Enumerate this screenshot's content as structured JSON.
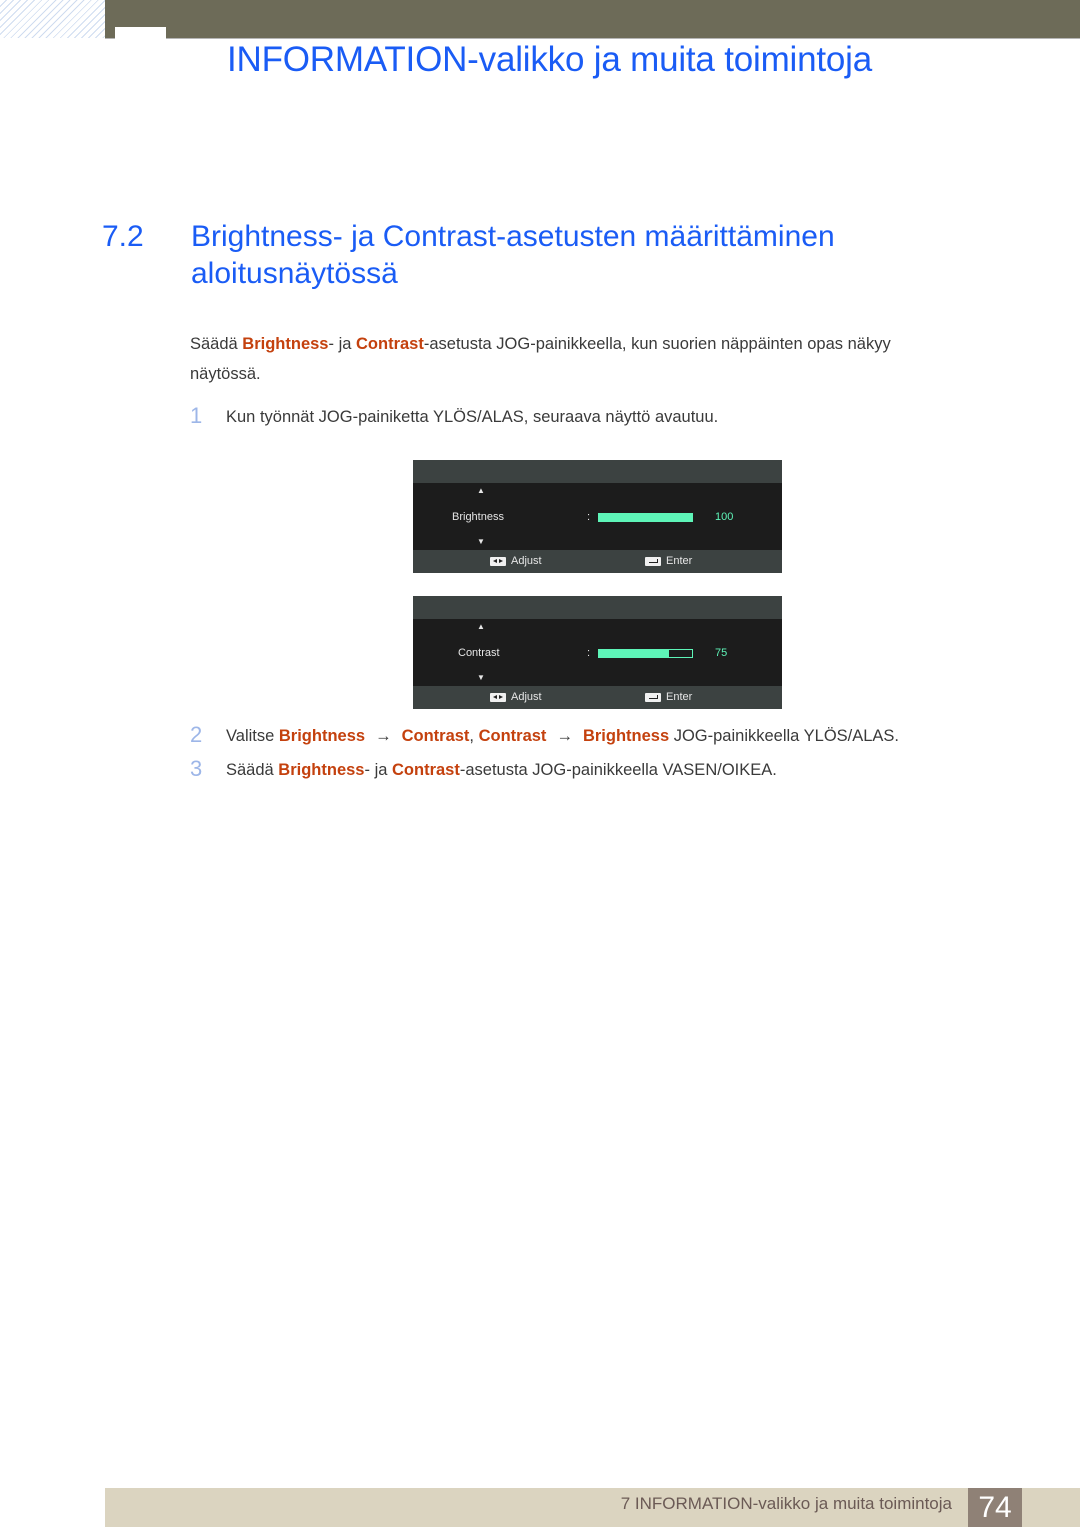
{
  "header": {
    "chapter_title": "INFORMATION-valikko ja muita toimintoja"
  },
  "section": {
    "number": "7.2",
    "title": "Brightness- ja Contrast-asetusten määrittäminen aloitusnäytössä"
  },
  "intro": {
    "part1": "Säädä ",
    "hl1": "Brightness",
    "part2": "- ja ",
    "hl2": "Contrast",
    "part3": "-asetusta JOG-painikkeella, kun suorien näppäinten opas näkyy näytössä."
  },
  "steps": [
    {
      "number": "1",
      "text": "Kun työnnät JOG-painiketta YLÖS/ALAS, seuraava näyttö avautuu."
    },
    {
      "number": "2",
      "part1": "Valitse ",
      "hl1": "Brightness",
      "arrow": "→",
      "hl2": "Contrast",
      "sep": ", ",
      "hl3": "Contrast",
      "hl4": "Brightness",
      "part2": " JOG-painikkeella YLÖS/ALAS."
    },
    {
      "number": "3",
      "part1": "Säädä ",
      "hl1": "Brightness",
      "part2": "- ja ",
      "hl2": "Contrast",
      "part3": "-asetusta JOG-painikkeella VASEN/OIKEA."
    }
  ],
  "osd_screens": [
    {
      "label": "Brightness",
      "colon": ":",
      "value": "100",
      "level_percent": 100,
      "up_icon": "▲",
      "down_icon": "▼",
      "footer": {
        "adjust": "Adjust",
        "enter": "Enter"
      }
    },
    {
      "label": "Contrast",
      "colon": ":",
      "value": "75",
      "level_percent": 75,
      "up_icon": "▲",
      "down_icon": "▼",
      "footer": {
        "adjust": "Adjust",
        "enter": "Enter"
      }
    }
  ],
  "footer": {
    "chapter_label": "7 INFORMATION-valikko ja muita toimintoja",
    "page_number": "74"
  },
  "colors": {
    "heading_blue": "#1a5cf5",
    "highlight_orange": "#c4410e",
    "osd_green": "#5ef5b8"
  }
}
